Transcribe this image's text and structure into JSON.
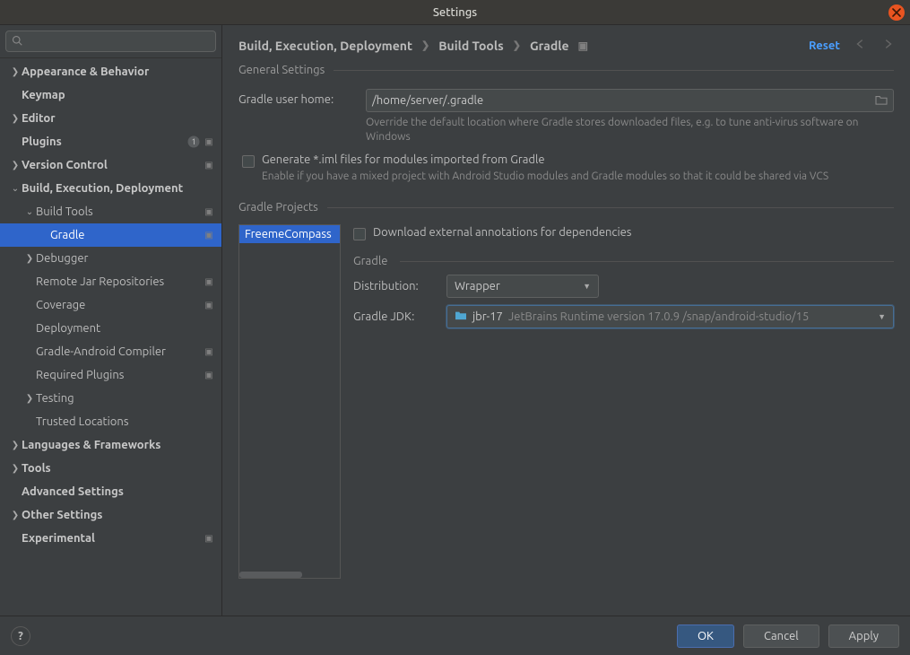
{
  "window": {
    "title": "Settings"
  },
  "search": {
    "placeholder": ""
  },
  "breadcrumb": [
    "Build, Execution, Deployment",
    "Build Tools",
    "Gradle"
  ],
  "header": {
    "reset": "Reset"
  },
  "sidebar": {
    "items": [
      {
        "label": "Appearance & Behavior",
        "depth": 0,
        "arrow": "right",
        "bold": true
      },
      {
        "label": "Keymap",
        "depth": 0,
        "arrow": "none",
        "bold": true
      },
      {
        "label": "Editor",
        "depth": 0,
        "arrow": "right",
        "bold": true
      },
      {
        "label": "Plugins",
        "depth": 0,
        "arrow": "none",
        "bold": true,
        "badge": "1",
        "marker": true
      },
      {
        "label": "Version Control",
        "depth": 0,
        "arrow": "right",
        "bold": true,
        "marker": true
      },
      {
        "label": "Build, Execution, Deployment",
        "depth": 0,
        "arrow": "down",
        "bold": true
      },
      {
        "label": "Build Tools",
        "depth": 1,
        "arrow": "down",
        "marker": true
      },
      {
        "label": "Gradle",
        "depth": 2,
        "arrow": "none",
        "selected": true,
        "marker": true
      },
      {
        "label": "Debugger",
        "depth": 1,
        "arrow": "right"
      },
      {
        "label": "Remote Jar Repositories",
        "depth": 1,
        "arrow": "none",
        "marker": true
      },
      {
        "label": "Coverage",
        "depth": 1,
        "arrow": "none",
        "marker": true
      },
      {
        "label": "Deployment",
        "depth": 1,
        "arrow": "none"
      },
      {
        "label": "Gradle-Android Compiler",
        "depth": 1,
        "arrow": "none",
        "marker": true
      },
      {
        "label": "Required Plugins",
        "depth": 1,
        "arrow": "none",
        "marker": true
      },
      {
        "label": "Testing",
        "depth": 1,
        "arrow": "right"
      },
      {
        "label": "Trusted Locations",
        "depth": 1,
        "arrow": "none"
      },
      {
        "label": "Languages & Frameworks",
        "depth": 0,
        "arrow": "right",
        "bold": true
      },
      {
        "label": "Tools",
        "depth": 0,
        "arrow": "right",
        "bold": true
      },
      {
        "label": "Advanced Settings",
        "depth": 0,
        "arrow": "none",
        "bold": true
      },
      {
        "label": "Other Settings",
        "depth": 0,
        "arrow": "right",
        "bold": true
      },
      {
        "label": "Experimental",
        "depth": 0,
        "arrow": "none",
        "bold": true,
        "marker": true
      }
    ]
  },
  "general": {
    "title": "General Settings",
    "userHomeLabel": "Gradle user home:",
    "userHomeValue": "/home/server/.gradle",
    "userHomeHelp": "Override the default location where Gradle stores downloaded files, e.g. to tune anti-virus software on Windows",
    "generateImlLabel": "Generate *.iml files for modules imported from Gradle",
    "generateImlHelp": "Enable if you have a mixed project with Android Studio modules and Gradle modules so that it could be shared via VCS"
  },
  "projects": {
    "title": "Gradle Projects",
    "list": [
      "FreemeCompass"
    ],
    "downloadAnnotations": "Download external annotations for dependencies",
    "gradleSub": "Gradle",
    "distributionLabel": "Distribution:",
    "distributionValue": "Wrapper",
    "jdkLabel": "Gradle JDK:",
    "jdkValue": "jbr-17",
    "jdkDetail": "JetBrains Runtime version 17.0.9 /snap/android-studio/15"
  },
  "footer": {
    "ok": "OK",
    "cancel": "Cancel",
    "apply": "Apply"
  }
}
